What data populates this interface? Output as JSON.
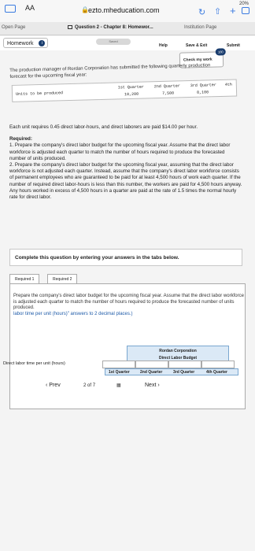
{
  "statusbar": {
    "aa": "AA",
    "url": "ezto.mheducation.com",
    "battery": "20%"
  },
  "tabs": [
    {
      "label": "Open Page"
    },
    {
      "label": "Question 2 - Chapter 8: Homewor..."
    },
    {
      "label": "Institution Page"
    }
  ],
  "navbar": {
    "homework_label": "Homework",
    "saved_label": "Saved",
    "help": "Help",
    "save_exit": "Save & Exit",
    "submit": "Submit"
  },
  "check_button": {
    "label": "Check my work",
    "badge": "100"
  },
  "problem": {
    "intro": "The production manager of Rordan Corporation has submitted the following quarterly production forecast for the upcoming fiscal year:",
    "table": {
      "row_label": "Units to be produced",
      "headers": [
        "1st Quarter",
        "2nd Quarter",
        "3rd Quarter",
        "4th"
      ],
      "values": [
        "10,200",
        "7,500",
        "8,100",
        ""
      ]
    },
    "rate_text": "Each unit requires 0.45 direct labor-hours, and direct laborers are paid $14.00 per hour.",
    "required_heading": "Required:",
    "req1": "1. Prepare the company's direct labor budget for the upcoming fiscal year. Assume that the direct labor workforce is adjusted each quarter to match the number of hours required to produce the forecasted number of units produced.",
    "req2": "2. Prepare the company's direct labor budget for the upcoming fiscal year, assuming that the direct labor workforce is not adjusted each quarter. Instead, assume that the company's direct labor workforce consists of permanent employees who are guaranteed to be paid for at least 4,500 hours of work each quarter. If the number of required direct labor-hours is less than this number, the workers are paid for 4,500 hours anyway. Any hours worked in excess of 4,500 hours in a quarter are paid at the rate of 1.5 times the normal hourly rate for direct labor."
  },
  "complete_note": "Complete this question by entering your answers in the tabs below.",
  "req_tabs": [
    {
      "label": "Required 1"
    },
    {
      "label": "Required 2"
    }
  ],
  "panel": {
    "instruction": "Prepare the company's direct labor budget for the upcoming fiscal year. Assume that the direct labor workforce is adjusted each quarter to match the number of hours required to produce the forecasted number of units produced.",
    "instruction_blue": "labor time per unit (hours)\" answers to 2 decimal places.)",
    "budget": {
      "company": "Rordan Corporation",
      "title": "Direct Labor Budget",
      "quarters": [
        "1st Quarter",
        "2nd Quarter",
        "3rd Quarter",
        "4th Quarter"
      ]
    },
    "row_label": "Direct labor time per unit (hours)"
  },
  "pager": {
    "prev": "Prev",
    "page": "2",
    "of": "of",
    "total": "7",
    "next": "Next"
  }
}
